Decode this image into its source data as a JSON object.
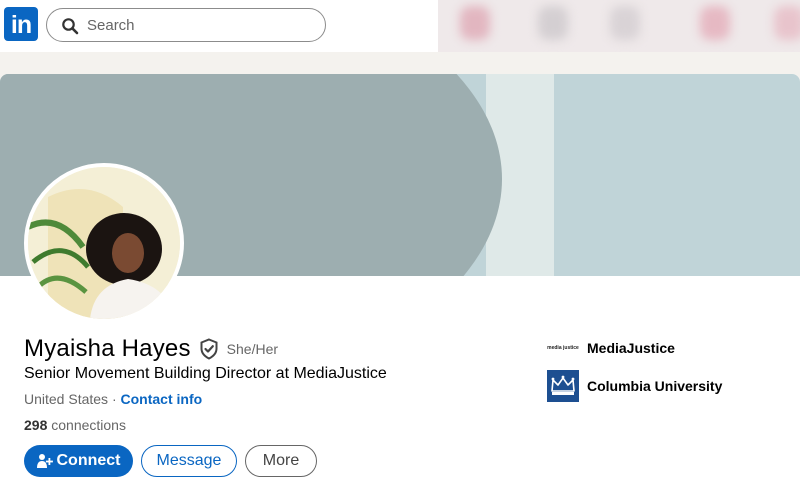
{
  "nav": {
    "logo_text": "in",
    "search_placeholder": "Search"
  },
  "profile": {
    "name": "Myaisha Hayes",
    "pronouns": "She/Her",
    "headline": "Senior Movement Building Director at MediaJustice",
    "location": "United States",
    "separator": " · ",
    "contact_label": "Contact info",
    "connections_count": "298",
    "connections_label": " connections"
  },
  "actions": {
    "connect_label": "Connect",
    "message_label": "Message",
    "more_label": "More"
  },
  "orgs": [
    {
      "name": "MediaJustice",
      "logo_text": "media justice"
    },
    {
      "name": "Columbia University"
    }
  ],
  "colors": {
    "brand_blue": "#0a66c2",
    "banner_dark": "#9daeb0",
    "banner_light": "#c0d4d8",
    "columbia_blue": "#1d4f91"
  }
}
